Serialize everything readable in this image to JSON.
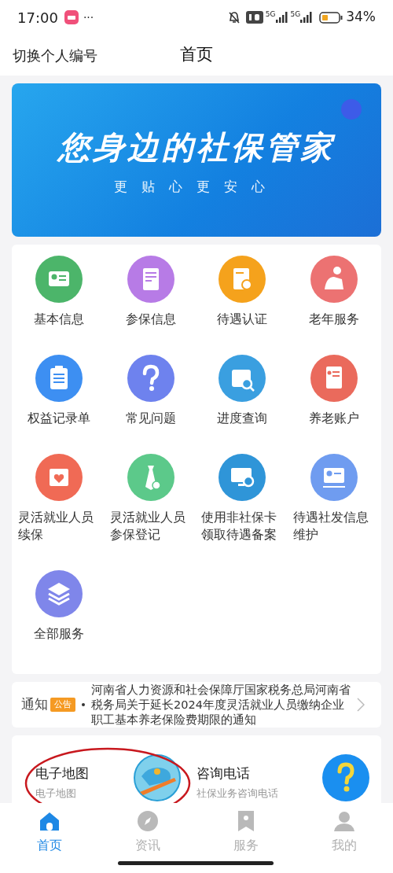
{
  "status_bar": {
    "time": "17:00",
    "more": "···",
    "network_1": "5G",
    "network_2": "5G",
    "battery": "34%"
  },
  "header": {
    "left": "切换个人编号",
    "title": "首页"
  },
  "banner": {
    "headline": "您身边的社保管家",
    "tagline": "更贴心更安心"
  },
  "services": [
    {
      "label": "基本信息",
      "color": "#4cb56a"
    },
    {
      "label": "参保信息",
      "color": "#b77be6"
    },
    {
      "label": "待遇认证",
      "color": "#f5a21c"
    },
    {
      "label": "老年服务",
      "color": "#ec7272"
    },
    {
      "label": "权益记录单",
      "color": "#3d8ff2"
    },
    {
      "label": "常见问题",
      "color": "#6e82ee"
    },
    {
      "label": "进度查询",
      "color": "#3a9fe0"
    },
    {
      "label": "养老账户",
      "color": "#ea6a5c"
    },
    {
      "label": "灵活就业人员续保",
      "color": "#f06a55"
    },
    {
      "label": "灵活就业人员参保登记",
      "color": "#5cc98a"
    },
    {
      "label": "使用非社保卡领取待遇备案",
      "color": "#2f95d8"
    },
    {
      "label": "待遇社发信息维护",
      "color": "#6f9cf0"
    },
    {
      "label": "全部服务",
      "color": "#7f86ea"
    }
  ],
  "notice": {
    "label": "通知",
    "badge": "公告",
    "text": "河南省人力资源和社会保障厅国家税务总局河南省税务局关于延长2024年度灵活就业人员缴纳企业职工基本养老保险费期限的通知"
  },
  "quick_links": [
    {
      "title": "电子地图",
      "subtitle": "电子地图",
      "circled": true
    },
    {
      "title": "咨询电话",
      "subtitle": "社保业务咨询电话",
      "circled": false
    }
  ],
  "tabs": [
    {
      "label": "首页",
      "selected": true
    },
    {
      "label": "资讯",
      "selected": false
    },
    {
      "label": "服务",
      "selected": false
    },
    {
      "label": "我的",
      "selected": false
    }
  ]
}
